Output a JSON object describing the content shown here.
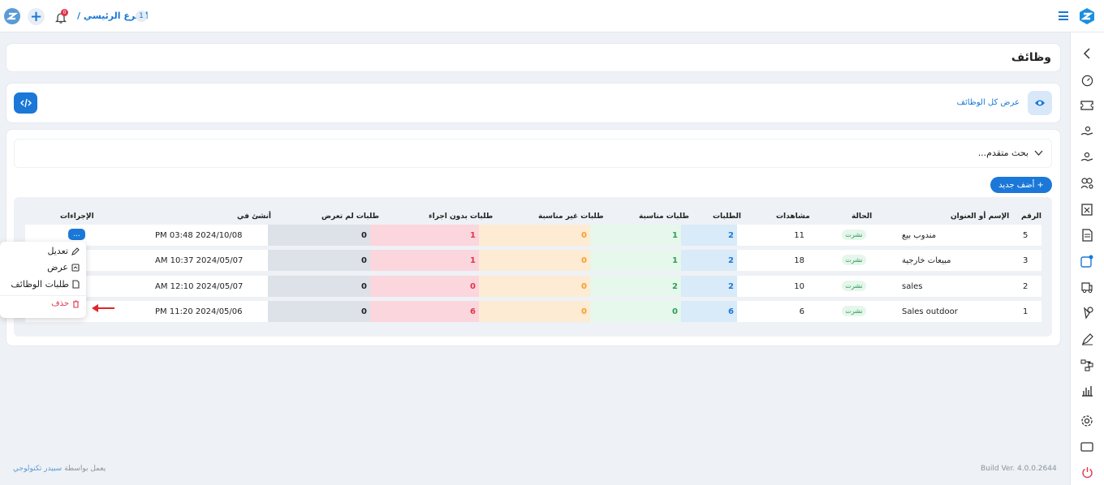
{
  "topbar": {
    "branch_number": "1",
    "branch_label": "الفرع الرئيسي /",
    "notification_count": "0"
  },
  "page_title": "وظائف",
  "toolbar": {
    "view_all_label": "عرض كل الوظائف"
  },
  "search": {
    "advanced_label": "بحث متقدم..."
  },
  "add_button_label": "+ أضف جديد",
  "table": {
    "headers": {
      "id": "الرقم",
      "name": "الإسم أو العنوان",
      "status": "الحالة",
      "views": "مشاهدات",
      "applications": "الطلبات",
      "suitable": "طلبات مناسبة",
      "unsuitable": "طلبات غير مناسبة",
      "no_action": "طلبات بدون اجراء",
      "not_viewed": "طلبات لم تعرض",
      "created": "أنشئ في",
      "actions": "الإجراءات"
    },
    "rows": [
      {
        "id": "5",
        "name": "مندوب بيع",
        "status": "نشرت",
        "views": "11",
        "applications": "2",
        "suitable": "1",
        "unsuitable": "0",
        "no_action": "1",
        "not_viewed": "0",
        "created": "2024/10/08 03:48 PM"
      },
      {
        "id": "3",
        "name": "مبيعات خارجية",
        "status": "نشرت",
        "views": "18",
        "applications": "2",
        "suitable": "1",
        "unsuitable": "0",
        "no_action": "1",
        "not_viewed": "0",
        "created": "2024/05/07 10:37 AM"
      },
      {
        "id": "2",
        "name": "sales",
        "status": "نشرت",
        "views": "10",
        "applications": "2",
        "suitable": "2",
        "unsuitable": "0",
        "no_action": "0",
        "not_viewed": "0",
        "created": "2024/05/07 12:10 AM"
      },
      {
        "id": "1",
        "name": "Sales outdoor",
        "status": "نشرت",
        "views": "6",
        "applications": "6",
        "suitable": "0",
        "unsuitable": "0",
        "no_action": "6",
        "not_viewed": "0",
        "created": "2024/05/06 11:20 PM"
      }
    ],
    "actions_button": "..."
  },
  "actions_menu": {
    "edit": "تعديل",
    "view": "عرض",
    "job_requests": "طلبات الوظائف",
    "delete": "حذف"
  },
  "footer": {
    "build": "Build Ver. 4.0.0.2644",
    "powered_prefix": "يعمل بواسطة",
    "powered_link": "سبيدر تكنولوجي"
  },
  "colors": {
    "brand": "#1b78d8",
    "applications_bg": "#d9eaf8",
    "suitable_bg": "#e6f7ec",
    "unsuitable_bg": "#fdebd3",
    "no_action_bg": "#fbd6dd",
    "not_viewed_bg": "#dde2e8"
  }
}
